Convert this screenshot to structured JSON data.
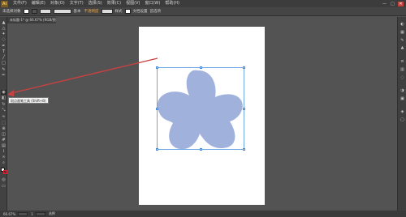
{
  "app": {
    "logo_text": "Ai",
    "menu": [
      "文件(F)",
      "编辑(E)",
      "对象(O)",
      "文字(T)",
      "选择(S)",
      "效果(C)",
      "视图(V)",
      "窗口(W)",
      "帮助(H)"
    ],
    "window_controls": [
      "—",
      "□",
      "✕"
    ]
  },
  "controlbar": {
    "label_none": "未选择对象",
    "label_basic": "基本",
    "label_opacity": "不透明度",
    "label_style": "样式",
    "label_transform": "文档设置",
    "label_preferences": "首选项"
  },
  "document": {
    "tab_label": "未标题-1* @ 66.67% (RGB/预览)"
  },
  "tooltip": {
    "text": "斑点画笔工具 (Shift+B)"
  },
  "statusbar": {
    "zoom": "66.67%",
    "page": "1",
    "tool_name": "选择"
  },
  "colors": {
    "flower_fill": "#a0b1dc",
    "selection": "#6fa7e6",
    "arrow": "#c94141",
    "artboard": "#ffffff",
    "workspace": "#535353"
  },
  "icons": {
    "tools": [
      "selection-arrow-icon",
      "direct-selection-icon",
      "magic-wand-icon",
      "lasso-icon",
      "pen-icon",
      "type-icon",
      "line-icon",
      "rectangle-icon",
      "paintbrush-icon",
      "pencil-icon",
      "blob-brush-icon",
      "eraser-icon",
      "rotate-icon",
      "scale-icon",
      "width-icon",
      "free-transform-icon",
      "shape-builder-icon",
      "perspective-icon",
      "mesh-icon",
      "gradient-icon",
      "eyedropper-icon",
      "blend-icon",
      "symbol-sprayer-icon",
      "graph-icon",
      "artboard-icon",
      "slice-icon",
      "hand-icon",
      "zoom-icon"
    ]
  }
}
